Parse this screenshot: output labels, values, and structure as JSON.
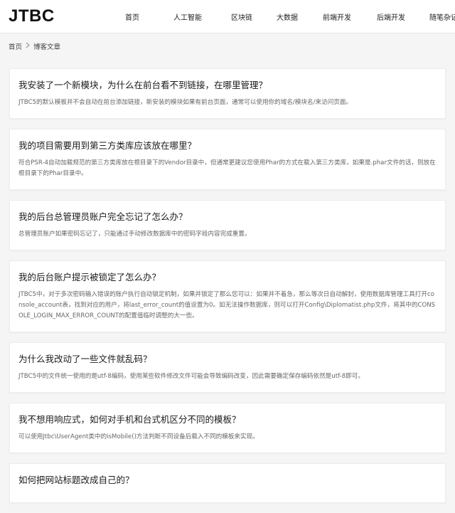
{
  "header": {
    "logo": "JTBC",
    "nav": [
      "首页",
      "人工智能",
      "区块链",
      "大数据",
      "前端开发",
      "后端开发",
      "随笔杂记"
    ]
  },
  "breadcrumb": {
    "home": "首页",
    "current": "博客文章"
  },
  "articles": [
    {
      "title": "我安装了一个新模块，为什么在前台看不到链接，在哪里管理？",
      "desc": "JTBC5的默认模板并不会自动在前台添加链接，新安装的模块如果有前台页面，通常可以使用你的域名/模块名/来访问页面。"
    },
    {
      "title": "我的项目需要用到第三方类库应该放在哪里？",
      "desc": "符合PSR-4自动加载规范的第三方类库放在根目录下的Vendor目录中，但通常更建议您使用Phar的方式在载入第三方类库，如果是.phar文件的话，则放在根目录下的Phar目录中。"
    },
    {
      "title": "我的后台总管理员账户完全忘记了怎么办？",
      "desc": "总管理员账户如果密码忘记了，只能通过手动修改数据库中的密码字段内容完成重置。"
    },
    {
      "title": "我的后台账户提示被锁定了怎么办？",
      "desc": "JTBC5中，对于多次密码输入错误的账户执行自动锁定机制，如果并锁定了那么您可以：如果并不着急，那么等次日自动解封，使用数据库管理工具打开console_account表，找到对应的用户，将last_error_count的值设置为0。如无法操作数据库，则可以打开Config\\Diplomatist.php文件，将其中的CONSOLE_LOGIN_MAX_ERROR_COUNT的配置值临时调整的大一些。"
    },
    {
      "title": "为什么我改动了一些文件就乱码？",
      "desc": "JTBC5中的文件统一使用的是utf-8编码，使用某些软件修改文件可能会导致编码改变，因此需要确定保存编码依然是utf-8即可。"
    },
    {
      "title": "我不想用响应式，如何对手机和台式机区分不同的模板？",
      "desc": "可以使用Jtbc\\UserAgent类中的isMobile()方法判断不同设备后载入不同的模板来实现。"
    },
    {
      "title": "如何把网站标题改成自己的？",
      "desc": ""
    }
  ]
}
